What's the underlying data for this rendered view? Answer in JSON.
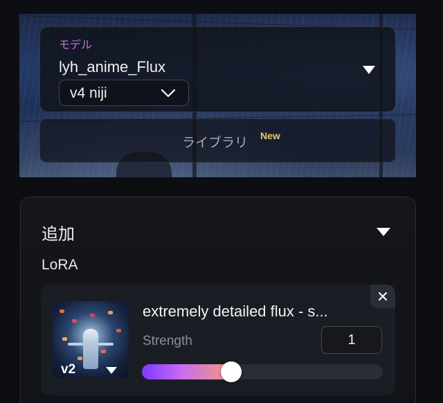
{
  "model": {
    "section_label": "モデル",
    "name": "lyh_anime_Flux",
    "version": "v4 niji",
    "toggle_icon": "triangle-down-icon",
    "version_chevron_icon": "chevron-down-icon"
  },
  "library": {
    "label": "ライブラリ",
    "badge": "New"
  },
  "add_panel": {
    "title": "追加",
    "toggle_icon": "triangle-down-icon",
    "lora_heading": "LoRA"
  },
  "lora": {
    "name": "extremely detailed flux - s...",
    "version": "v2",
    "strength_label": "Strength",
    "strength_value": "1",
    "slider_fraction": 0.37,
    "close_icon": "close-icon",
    "thumbnail": "lora-thumbnail-image"
  },
  "colors": {
    "accent_pink": "#c86bdc",
    "badge_yellow": "#e7c86e",
    "slider_start": "#7e39ff",
    "slider_end": "#f59a7c"
  }
}
